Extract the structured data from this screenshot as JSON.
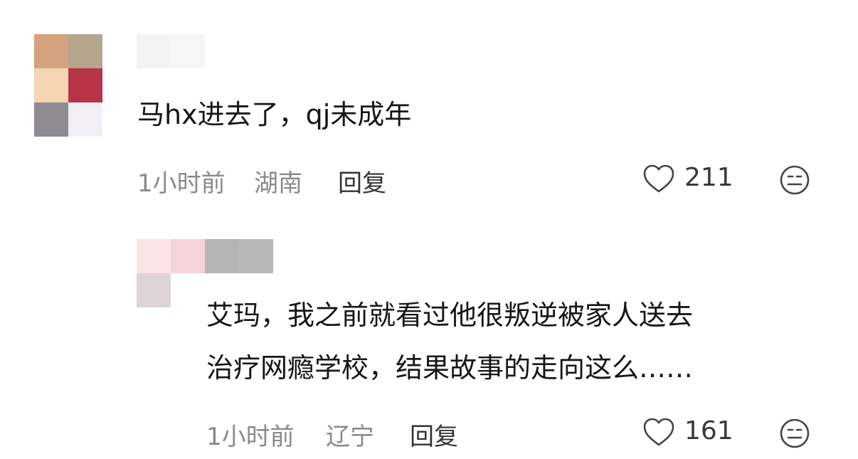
{
  "comments": [
    {
      "text": "马hx进去了，qj未成年",
      "time": "1小时前",
      "location": "湖南",
      "reply_label": "回复",
      "likes": "211",
      "icons": {
        "like": "heart-outline-icon",
        "react": "neutral-face-icon"
      }
    },
    {
      "text_line1": "艾玛，我之前就看过他很叛逆被家人送去",
      "text_line2": "治疗网瘾学校，结果故事的走向这么……",
      "time": "1小时前",
      "location": "辽宁",
      "reply_label": "回复",
      "likes": "161",
      "icons": {
        "like": "heart-outline-icon",
        "react": "neutral-face-icon"
      }
    }
  ],
  "colors": {
    "avatar1": [
      "#d5a27f",
      "#b5a58d",
      "#f6d5b5",
      "#b83346",
      "#8e8c92",
      "#f1eff4"
    ],
    "username1": [
      "#f3f3f3",
      "#f6f6f6"
    ],
    "avatar2": [
      "#fbe3e6",
      "#f5d3d9",
      "#ded4d8"
    ],
    "username2": [
      "#b5b5b5",
      "#b8b8b8"
    ]
  }
}
